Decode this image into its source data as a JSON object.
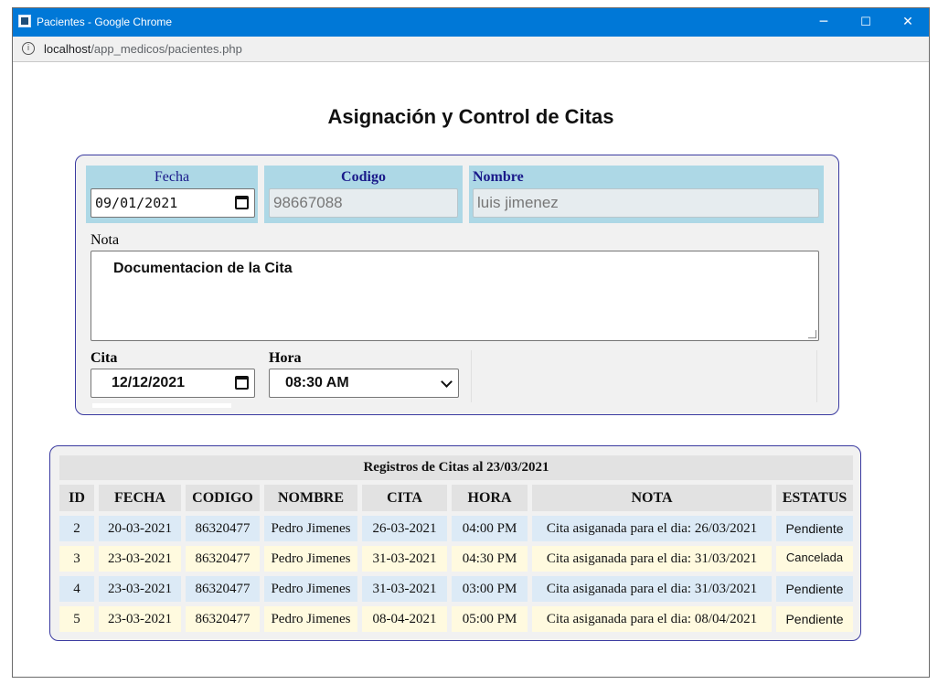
{
  "window": {
    "title": "Pacientes - Google Chrome",
    "controls": {
      "minimize": "─",
      "maximize": "☐",
      "close": "✕"
    }
  },
  "address": {
    "host": "localhost",
    "path": "/app_medicos/pacientes.php"
  },
  "page": {
    "title": "Asignación y Control de Citas"
  },
  "form": {
    "fecha": {
      "label": "Fecha",
      "value": "09/01/2021"
    },
    "codigo": {
      "label": "Codigo",
      "value": "98667088"
    },
    "nombre": {
      "label": "Nombre",
      "value": "luis jimenez"
    },
    "nota": {
      "label": "Nota",
      "value": "Documentacion de la Cita"
    },
    "cita": {
      "label": "Cita",
      "value": "12/12/2021"
    },
    "hora": {
      "label": "Hora",
      "value": "08:30 AM"
    }
  },
  "table": {
    "caption": "Registros de Citas al 23/03/2021",
    "headers": [
      "ID",
      "FECHA",
      "CODIGO",
      "NOMBRE",
      "CITA",
      "HORA",
      "NOTA",
      "ESTATUS"
    ],
    "rows": [
      {
        "id": "2",
        "fecha": "20-03-2021",
        "codigo": "86320477",
        "nombre": "Pedro Jimenes",
        "cita": "26-03-2021",
        "hora": "04:00 PM",
        "nota": "Cita asiganada para el dia: 26/03/2021",
        "estatus": "Pendiente"
      },
      {
        "id": "3",
        "fecha": "23-03-2021",
        "codigo": "86320477",
        "nombre": "Pedro Jimenes",
        "cita": "31-03-2021",
        "hora": "04:30 PM",
        "nota": "Cita asiganada para el dia: 31/03/2021",
        "estatus": "Cancelada"
      },
      {
        "id": "4",
        "fecha": "23-03-2021",
        "codigo": "86320477",
        "nombre": "Pedro Jimenes",
        "cita": "31-03-2021",
        "hora": "03:00 PM",
        "nota": "Cita asiganada para el dia: 31/03/2021",
        "estatus": "Pendiente"
      },
      {
        "id": "5",
        "fecha": "23-03-2021",
        "codigo": "86320477",
        "nombre": "Pedro Jimenes",
        "cita": "08-04-2021",
        "hora": "05:00 PM",
        "nota": "Cita asiganada para el dia: 08/04/2021",
        "estatus": "Pendiente"
      }
    ]
  },
  "colors": {
    "titlebar": "#0078d7",
    "field_highlight": "#add8e6",
    "panel_border": "#3a3aa0",
    "row_blue": "#dceaf6",
    "row_yellow": "#fffadf"
  },
  "icons": {
    "app": "app-icon",
    "info": "info-icon",
    "calendar": "calendar-icon",
    "dropdown": "chevron-down-icon"
  }
}
